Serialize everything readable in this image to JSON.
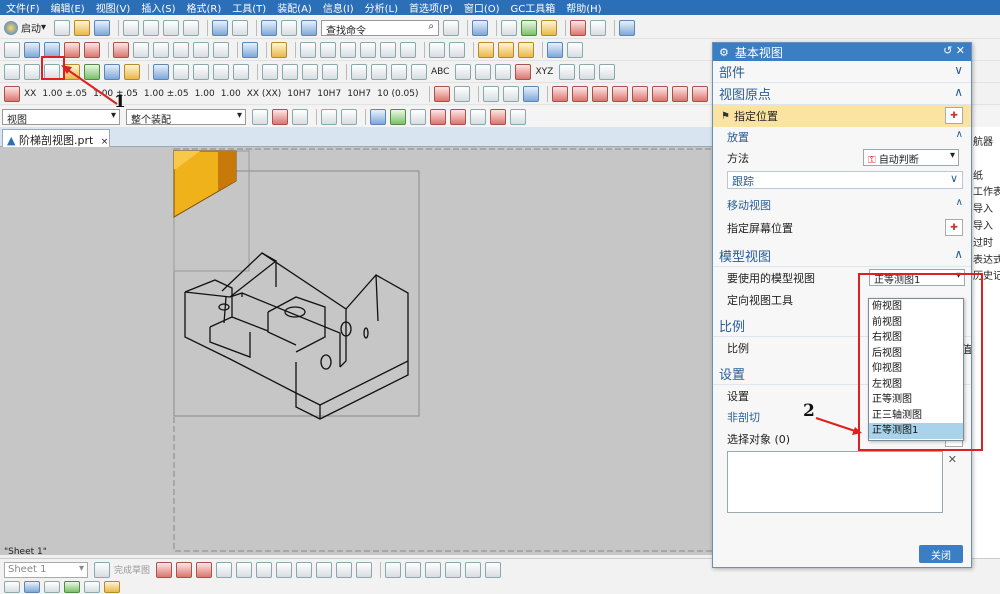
{
  "menu": [
    "文件(F)",
    "编辑(E)",
    "视图(V)",
    "插入(S)",
    "格式(R)",
    "工具(T)",
    "装配(A)",
    "信息(I)",
    "分析(L)",
    "首选项(P)",
    "窗口(O)",
    "GC工具箱",
    "帮助(H)"
  ],
  "toolbar": {
    "start_label": "启动",
    "find_placeholder": "查找命令",
    "tolerance_labels": [
      "XX",
      "1.00 ±.05",
      "1.00 ±.05",
      "1.00 ±.05",
      "1.00",
      "1.00",
      "XX (XX)",
      "10H7",
      "10H7",
      "10H7",
      "10 (0.05)"
    ],
    "xyz_label": "XYZ",
    "abc_label": "ABC"
  },
  "modebar": {
    "view_filter": "视图",
    "assembly_filter": "整个装配"
  },
  "doc_tab": {
    "title": "阶梯剖视图.prt",
    "close": "×"
  },
  "canvas": {
    "sheet_label": "\"Sheet 1\""
  },
  "bottom": {
    "sheet_select": "Sheet 1",
    "sketch_label": "完成草图"
  },
  "annotations": {
    "one": "1",
    "two": "2"
  },
  "navigator": [
    "航器",
    "纸",
    "工作表",
    "导入",
    "导入",
    "过时",
    "表达式",
    "历史记"
  ],
  "dialog": {
    "title": "基本视图",
    "title_controls": "↺ ✕",
    "sections": {
      "part": "部件",
      "view_origin": "视图原点",
      "specify_location": "指定位置",
      "placement": "放置",
      "method_label": "方法",
      "method_value": "自动判断",
      "tracking": "跟踪",
      "move_view": "移动视图",
      "specify_screen_location": "指定屏幕位置",
      "model_view": "模型视图",
      "model_view_label": "要使用的模型视图",
      "model_view_value": "正等测图1",
      "orient_tool": "定向视图工具",
      "scale": "比例",
      "scale_label": "比例",
      "scale_value_partial": "值",
      "settings": "设置",
      "settings_label": "设置",
      "non_section": "非剖切",
      "select_objects": "选择对象 (0)",
      "close_button": "关闭"
    },
    "model_view_options": [
      "俯视图",
      "前视图",
      "右视图",
      "后视图",
      "仰视图",
      "左视图",
      "正等测图",
      "正三轴测图",
      "正等测图1"
    ],
    "selected_option": "正等测图1"
  },
  "colors": {
    "title_blue": "#3b7ec4",
    "section_text": "#2a5d96",
    "highlight_row": "#fbe4a2",
    "selected_option": "#a9d3ea",
    "annotation_red": "#e02020",
    "canvas_gray": "#c6c6c6",
    "model_orange": "#e8a012"
  }
}
